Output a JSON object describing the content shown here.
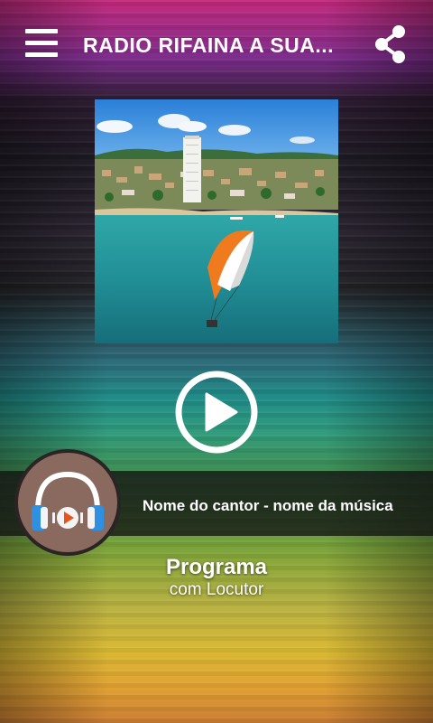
{
  "header": {
    "title": "RADIO RIFAINA A SUA...",
    "menu_icon": "hamburger-menu-icon",
    "share_icon": "share-icon"
  },
  "artwork": {
    "alt": "aerial photo of lakeside city with paraglider"
  },
  "player": {
    "play_icon": "play-icon",
    "now_playing": "Nome do cantor - nome da música",
    "avatar_icon": "headphones-play-icon"
  },
  "program": {
    "title": "Programa",
    "host": "com Locutor"
  },
  "colors": {
    "accent_orange": "#e8541e",
    "headphone_blue": "#2f8fe0",
    "avatar_bg": "#8a6a5e"
  }
}
